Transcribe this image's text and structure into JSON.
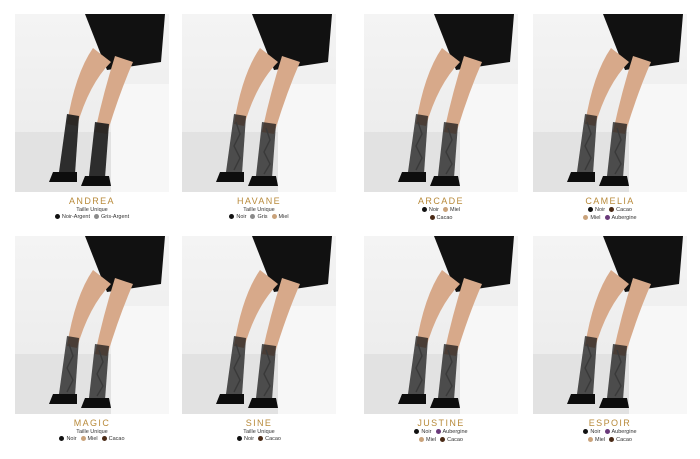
{
  "products": [
    {
      "name": "ANDREA",
      "subtitle": "Taille Unique",
      "swatch_rows": [
        [
          {
            "label": "Noir-Argent",
            "color": "#111111"
          },
          {
            "label": "Gris-Argent",
            "color": "#8a8a8a"
          }
        ]
      ]
    },
    {
      "name": "HAVANE",
      "subtitle": "Taille Unique",
      "swatch_rows": [
        [
          {
            "label": "Noir",
            "color": "#111111"
          },
          {
            "label": "Gris",
            "color": "#8a8a8a"
          },
          {
            "label": "Miel",
            "color": "#c9a27a"
          }
        ]
      ]
    },
    {
      "name": "ARCADE",
      "subtitle": "",
      "swatch_rows": [
        [
          {
            "label": "Noir",
            "color": "#111111"
          },
          {
            "label": "Miel",
            "color": "#c9a27a"
          }
        ],
        [
          {
            "label": "Cacao",
            "color": "#4a2a16"
          }
        ]
      ]
    },
    {
      "name": "CAMELIA",
      "subtitle": "",
      "swatch_rows": [
        [
          {
            "label": "Noir",
            "color": "#111111"
          },
          {
            "label": "Cacao",
            "color": "#4a2a16"
          }
        ],
        [
          {
            "label": "Miel",
            "color": "#c9a27a"
          },
          {
            "label": "Aubergine",
            "color": "#6a3a7a"
          }
        ]
      ]
    },
    {
      "name": "MAGIC",
      "subtitle": "Taille Unique",
      "swatch_rows": [
        [
          {
            "label": "Noir",
            "color": "#111111"
          },
          {
            "label": "Miel",
            "color": "#c9a27a"
          },
          {
            "label": "Cacao",
            "color": "#4a2a16"
          }
        ]
      ]
    },
    {
      "name": "SINE",
      "subtitle": "Taille Unique",
      "swatch_rows": [
        [
          {
            "label": "Noir",
            "color": "#111111"
          },
          {
            "label": "Cacao",
            "color": "#4a2a16"
          }
        ]
      ]
    },
    {
      "name": "JUSTINE",
      "subtitle": "",
      "swatch_rows": [
        [
          {
            "label": "Noir",
            "color": "#111111"
          },
          {
            "label": "Aubergine",
            "color": "#6a3a7a"
          }
        ],
        [
          {
            "label": "Miel",
            "color": "#c9a27a"
          },
          {
            "label": "Cacao",
            "color": "#4a2a16"
          }
        ]
      ]
    },
    {
      "name": "ESPOIR",
      "subtitle": "",
      "swatch_rows": [
        [
          {
            "label": "Noir",
            "color": "#111111"
          },
          {
            "label": "Aubergine",
            "color": "#6a3a7a"
          }
        ],
        [
          {
            "label": "Miel",
            "color": "#c9a27a"
          },
          {
            "label": "Cacao",
            "color": "#4a2a16"
          }
        ]
      ]
    }
  ]
}
